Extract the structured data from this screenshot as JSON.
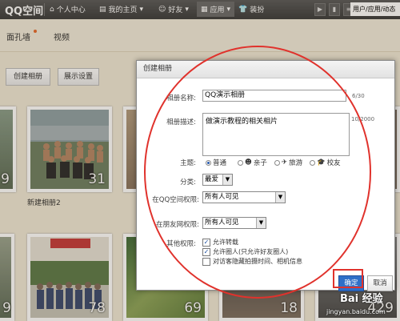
{
  "nav": {
    "logo": "QQ空间",
    "personal": "个人中心",
    "home": "我的主页",
    "friends": "好友",
    "apps": "应用",
    "decorate": "装扮",
    "user_tab": "用户/应用/动态"
  },
  "subnav": {
    "tab1": "面孔墙",
    "tab2": "视频"
  },
  "toolbar": {
    "create_album": "创建相册",
    "display_settings": "展示设置"
  },
  "albums": [
    {
      "count": "9",
      "name": ""
    },
    {
      "count": "31",
      "name": "新建相册2"
    },
    {
      "count": "",
      "name": ""
    },
    {
      "count": "9",
      "name": ""
    },
    {
      "count": "78",
      "name": ""
    },
    {
      "count": "69",
      "name": ""
    },
    {
      "count": "18",
      "name": ""
    },
    {
      "count": "429",
      "name": ""
    }
  ],
  "dialog": {
    "title": "创建相册",
    "name_label": "相册名称:",
    "name_value": "QQ演示相册",
    "name_count": "6/30",
    "desc_label": "相册描述:",
    "desc_value": "做演示教程的相关相片",
    "desc_count": "10/2000",
    "theme_label": "主题:",
    "themes": [
      "普通",
      "亲子",
      "旅游",
      "校友"
    ],
    "category_label": "分类:",
    "category_value": "最爱",
    "qq_perm_label": "在QQ空间权限:",
    "qq_perm_value": "所有人可见",
    "friend_perm_label": "在朋友网权限:",
    "friend_perm_value": "所有人可见",
    "other_label": "其他权限:",
    "opt1": "允许转载",
    "opt2": "允许圈人(只允许好友圈人)",
    "opt3": "对访客隐藏拍摄时间、相机信息",
    "ok": "确定",
    "cancel": "取消"
  },
  "watermark": "jingyan.baidu.com",
  "watermark_brand": "Bai 经验"
}
